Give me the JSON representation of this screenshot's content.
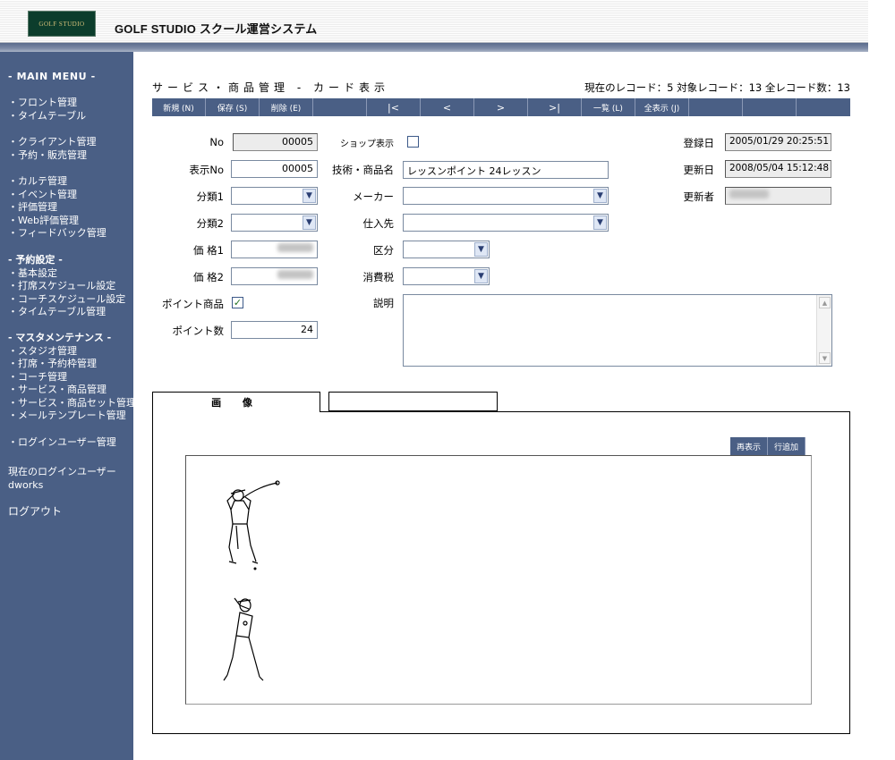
{
  "header": {
    "logo_text": "GOLF STUDIO",
    "app_title": "GOLF STUDIO スクール運営システム"
  },
  "sidebar": {
    "menu_title": "- MAIN MENU -",
    "groups": [
      [
        "・フロント管理",
        "・タイムテーブル"
      ],
      [
        "・クライアント管理",
        "・予約・販売管理"
      ],
      [
        "・カルテ管理",
        "・イベント管理",
        "・評価管理",
        "・Web評価管理",
        "・フィードバック管理"
      ],
      [
        "- 予約設定 -",
        "・基本設定",
        "・打席スケジュール設定",
        "・コーチスケジュール設定",
        "・タイムテーブル管理"
      ],
      [
        "- マスタメンテナンス -",
        "・スタジオ管理",
        "・打席・予約枠管理",
        "・コーチ管理",
        "・サービス・商品管理",
        "・サービス・商品セット管理",
        "・メールテンプレート管理"
      ],
      [
        "・ログインユーザー管理"
      ],
      [
        "現在のログインユーザー",
        "dworks"
      ],
      [
        "ログアウト"
      ]
    ]
  },
  "page": {
    "title": "サービス・商品管理 - カード表示",
    "record_info": "現在のレコード：5  対象レコード：13  全レコード数：13"
  },
  "toolbar": {
    "new": "新規 (N)",
    "save": "保存 (S)",
    "delete": "削除 (E)",
    "first": "|<",
    "prev": "<",
    "next": ">",
    "last": ">|",
    "list": "一覧 (L)",
    "show_all": "全表示 (J)"
  },
  "form": {
    "no_label": "No",
    "no_value": "00005",
    "display_no_label": "表示No",
    "display_no_value": "00005",
    "category1_label": "分類1",
    "category2_label": "分類2",
    "price1_label": "価 格1",
    "price2_label": "価 格2",
    "point_item_label": "ポイント商品",
    "point_item_checked": true,
    "points_label": "ポイント数",
    "points_value": "24",
    "shop_display_label": "ショップ表示",
    "shop_display_checked": false,
    "name_label": "技術・商品名",
    "name_value": "レッスンポイント 24レッスン",
    "maker_label": "メーカー",
    "supplier_label": "仕入先",
    "division_label": "区分",
    "tax_label": "消費税",
    "description_label": "説明",
    "registered_label": "登録日",
    "registered_value": "2005/01/29 20:25:51",
    "updated_label": "更新日",
    "updated_value": "2008/05/04 15:12:48",
    "updated_by_label": "更新者"
  },
  "tabs": {
    "image": "画 像",
    "second": ""
  },
  "image_panel": {
    "redisplay": "再表示",
    "add_row": "行追加"
  }
}
